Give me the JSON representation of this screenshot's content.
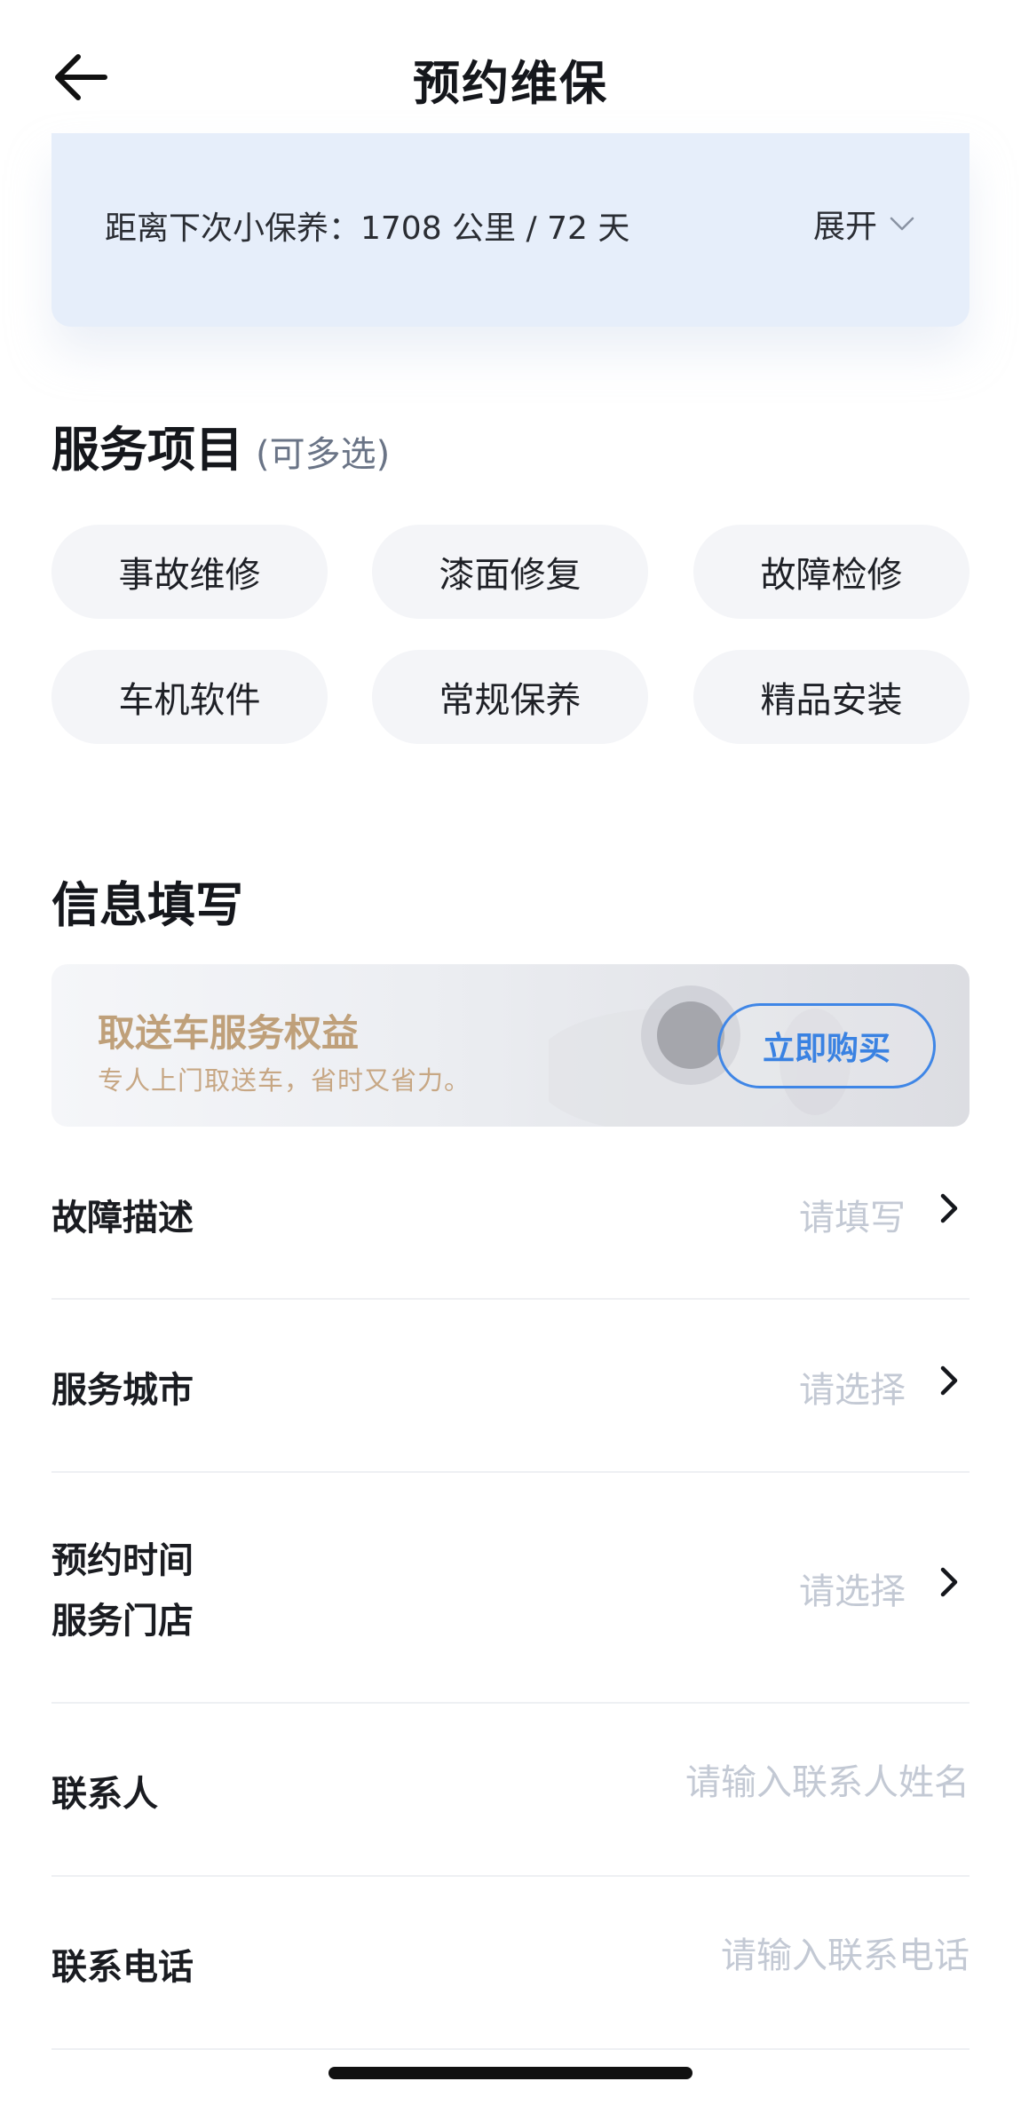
{
  "header": {
    "title": "预约维保"
  },
  "maintenance": {
    "next_service_text": "距离下次小保养：1708 公里 / 72 天",
    "expand_label": "展开"
  },
  "services": {
    "title": "服务项目",
    "subtitle": "(可多选)",
    "chips": [
      "事故维修",
      "漆面修复",
      "故障检修",
      "车机软件",
      "常规保养",
      "精品安装"
    ]
  },
  "info": {
    "title": "信息填写"
  },
  "promo": {
    "title": "取送车服务权益",
    "subtitle": "专人上门取送车，省时又省力。",
    "button": "立即购买"
  },
  "form": {
    "fault": {
      "label": "故障描述",
      "placeholder": "请填写"
    },
    "city": {
      "label": "服务城市",
      "placeholder": "请选择"
    },
    "time_store": {
      "label_line1": "预约时间",
      "label_line2": "服务门店",
      "placeholder": "请选择"
    },
    "contact": {
      "label": "联系人",
      "placeholder": "请输入联系人姓名"
    },
    "phone": {
      "label": "联系电话",
      "placeholder": "请输入联系电话"
    }
  },
  "colors": {
    "accent": "#3a82e2",
    "card_bg": "#e6eefa",
    "chip_bg": "#f4f5f8",
    "promo_gold": "#bfa07a",
    "placeholder": "#c3c9d4"
  }
}
